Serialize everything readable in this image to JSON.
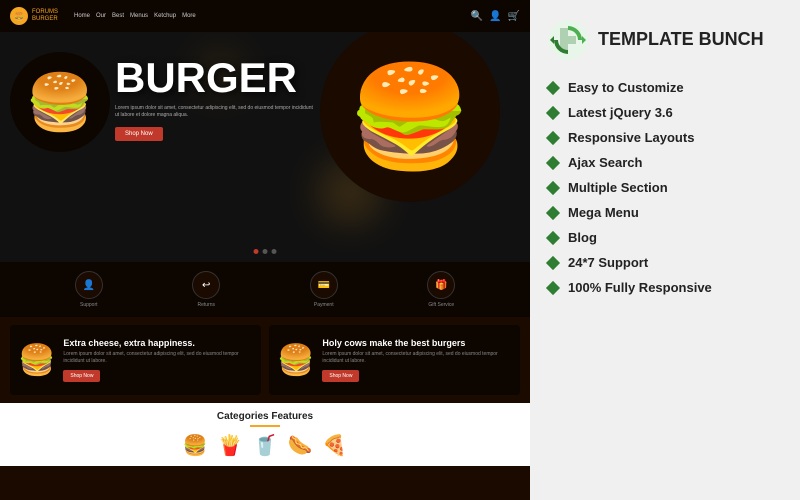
{
  "preview": {
    "navbar": {
      "logo_icon": "🍔",
      "logo_name": "FORUMS",
      "logo_sub": "BURGER",
      "nav_items": [
        "Home",
        "Our",
        "Best",
        "Menus",
        "Ketchup",
        "More"
      ],
      "search_icon": "🔍",
      "user_icon": "👤",
      "cart_icon": "🛒"
    },
    "hero": {
      "title": "BURGER",
      "description": "Lorem ipsum dolor sit amet, consectetur adipiscing elit, sed do eiusmod tempor incididunt ut labore et dolore magna aliqua.",
      "cta_label": "Shop Now",
      "dots": [
        true,
        false,
        false
      ]
    },
    "icon_bar": {
      "items": [
        {
          "icon": "👤",
          "label": "Support"
        },
        {
          "icon": "↩",
          "label": "Returns"
        },
        {
          "icon": "💳",
          "label": "Payment"
        },
        {
          "icon": "🎁",
          "label": "Gift Service"
        }
      ]
    },
    "product_cards": [
      {
        "emoji": "🍔",
        "title": "Extra cheese, extra happiness.",
        "description": "Lorem ipsum dolor sit amet, consectetur adipiscing elit, sed do eiusmod tempor incididunt ut labore.",
        "cta": "Shop Now"
      },
      {
        "emoji": "🍔",
        "title": "Holy cows make the best burgers",
        "description": "Lorem ipsum dolor sit amet, consectetur adipiscing elit, sed do eiusmod tempor incididunt ut labore.",
        "cta": "Shop Now"
      }
    ],
    "categories": {
      "title": "Categories Features",
      "items": [
        "🍔",
        "🍟",
        "🥤",
        "🌭",
        "🍕"
      ]
    }
  },
  "info_panel": {
    "brand_name": "teMpLATe BUNCH",
    "brand_name_display": "TEMPLATE BUNCH",
    "features": [
      "Easy to Customize",
      "Latest jQuery 3.6",
      "Responsive Layouts",
      "Ajax Search",
      "Multiple Section",
      "Mega Menu",
      "Blog",
      "24*7 Support",
      "100% Fully Responsive"
    ]
  }
}
